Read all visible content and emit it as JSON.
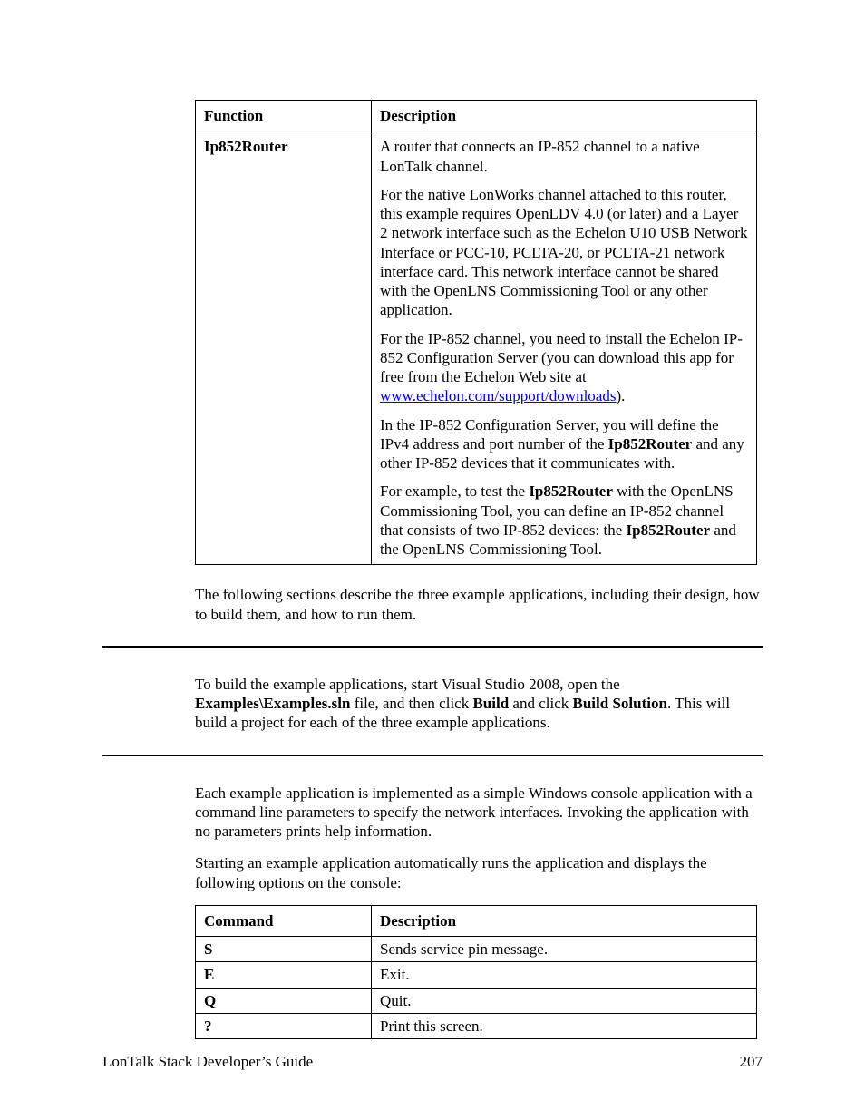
{
  "table1": {
    "header": {
      "c1": "Function",
      "c2": "Description"
    },
    "row1": {
      "func": "Ip852Router",
      "p1": "A router that connects an IP-852 channel to a native LonTalk channel.",
      "p2": "For the native LonWorks channel attached to this router, this example requires OpenLDV 4.0 (or later) and a Layer 2 network interface such as the Echelon U10 USB Network Interface or PCC-10, PCLTA-20, or PCLTA-21 network interface card.  This network interface cannot be shared with the OpenLNS Commissioning Tool or any other application.",
      "p3_a": "For the IP-852 channel, you need to install the Echelon IP-852 Configuration Server (you can download this app for free from the Echelon Web site at ",
      "p3_link": "www.echelon.com/support/downloads",
      "p3_b": ").",
      "p4_a": "In the IP-852 Configuration Server, you will define the IPv4 address and port number of the ",
      "p4_b1": "Ip852Router",
      "p4_c": " and any other IP-852 devices that it communicates with.",
      "p5_a": "For example, to test the ",
      "p5_b1": "Ip852Router",
      "p5_c": " with the OpenLNS Commissioning Tool, you can define an IP-852 channel that consists of two IP-852 devices: the ",
      "p5_b2": "Ip852Router",
      "p5_d": " and the OpenLNS Commissioning Tool."
    }
  },
  "para_after_t1": "The following sections describe the three example applications, including their design, how to build them, and how to run them.",
  "build": {
    "a": "To build the example applications, start Visual Studio 2008, open the ",
    "b1": "Examples\\Examples.sln",
    "c": " file, and then click ",
    "b2": "Build",
    "d": " and click ",
    "b3": "Build Solution",
    "e": ". This will build a project for each of the three example applications."
  },
  "run": {
    "p1": "Each example application is implemented as a simple Windows console application with a command line parameters to specify the network interfaces. Invoking the application with no parameters prints help information.",
    "p2": "Starting an example application automatically runs the application and displays the following options on the console:"
  },
  "table2": {
    "header": {
      "c1": "Command",
      "c2": "Description"
    },
    "rows": [
      {
        "cmd": "S",
        "desc": "Sends service pin message."
      },
      {
        "cmd": "E",
        "desc": "Exit."
      },
      {
        "cmd": "Q",
        "desc": "Quit."
      },
      {
        "cmd": "?",
        "desc": "Print this screen."
      }
    ]
  },
  "footer": {
    "title": "LonTalk Stack Developer’s Guide",
    "page": "207"
  }
}
